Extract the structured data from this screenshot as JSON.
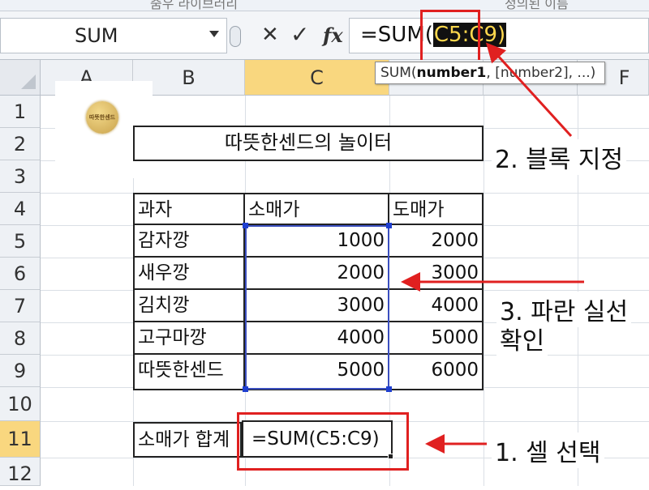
{
  "ribbon": {
    "left_text": "줌우 라이브러리",
    "right_text": "정의된 이름"
  },
  "formula_bar": {
    "name_box": "SUM",
    "cancel_icon": "✕",
    "enter_icon": "✓",
    "fx_label": "fx",
    "formula_prefix": "=SUM(",
    "formula_ref": "C5:C9)",
    "tooltip_func": "SUM(",
    "tooltip_arg1": "number1",
    "tooltip_rest": ", [number2], ...)"
  },
  "columns": [
    "A",
    "B",
    "C",
    "D",
    "E",
    "F"
  ],
  "rows": [
    "1",
    "2",
    "3",
    "4",
    "5",
    "6",
    "7",
    "8",
    "9",
    "10",
    "11",
    "12"
  ],
  "sheet": {
    "logo_text": "따뜻한센드",
    "title": "따뜻한센드의 놀이터",
    "table_headers": [
      "과자",
      "소매가",
      "도매가"
    ],
    "table_rows": [
      {
        "name": "감자깡",
        "retail": "1000",
        "wholesale": "2000"
      },
      {
        "name": "새우깡",
        "retail": "2000",
        "wholesale": "3000"
      },
      {
        "name": "김치깡",
        "retail": "3000",
        "wholesale": "4000"
      },
      {
        "name": "고구마깡",
        "retail": "4000",
        "wholesale": "5000"
      },
      {
        "name": "따뜻한센드",
        "retail": "5000",
        "wholesale": "6000"
      }
    ],
    "sum_label": "소매가 합계",
    "sum_formula": "=SUM(C5:C9)"
  },
  "annotations": {
    "step1": "1. 셀 선택",
    "step2": "2. 블록 지정",
    "step3_line1": "3. 파란 실선",
    "step3_line2": "확인"
  },
  "colors": {
    "annotation_red": "#e02020",
    "range_blue": "#3b4fbf",
    "header_selected": "#f9d77f"
  }
}
